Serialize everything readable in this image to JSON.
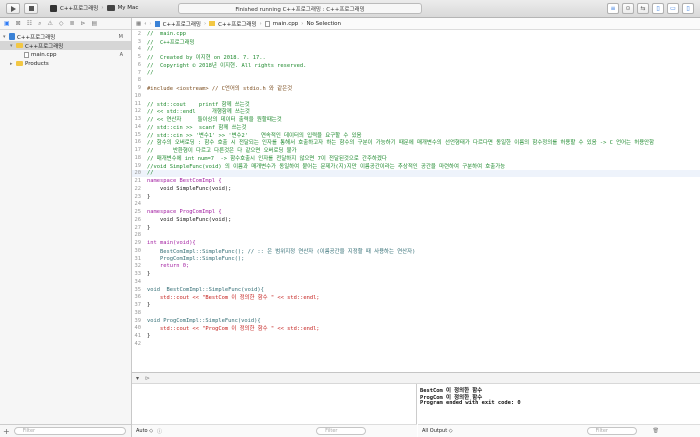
{
  "toolbar": {
    "scheme_target": "C++프로그래밍",
    "scheme_device": "My Mac",
    "status_text": "Finished running C++프로그래밍 : C++프로그래밍"
  },
  "navigator": {
    "project": {
      "name": "C++프로그래밍",
      "badge": "M"
    },
    "group": {
      "name": "C++프로그래밍"
    },
    "file": {
      "name": "main.cpp",
      "badge": "A"
    },
    "products": {
      "name": "Products"
    },
    "filter_placeholder": "Filter"
  },
  "jumpbar": {
    "crumbs": [
      "C++프로그래밍",
      "C++프로그래밍",
      "main.cpp",
      "No Selection"
    ]
  },
  "editor": {
    "lines": [
      {
        "n": "2",
        "t": "//  main.cpp",
        "c": "c-comment"
      },
      {
        "n": "3",
        "t": "//  C++프로그래밍",
        "c": "c-comment"
      },
      {
        "n": "4",
        "t": "//",
        "c": "c-comment"
      },
      {
        "n": "5",
        "t": "//  Created by 이지현 on 2018. 7. 17..",
        "c": "c-comment"
      },
      {
        "n": "6",
        "t": "//  Copyright © 2018년 이지현. All rights reserved.",
        "c": "c-comment"
      },
      {
        "n": "7",
        "t": "//",
        "c": "c-comment"
      },
      {
        "n": "8",
        "t": "",
        "c": "c-plain"
      },
      {
        "n": "9",
        "t": "#include <iostream> // C언어의 stdio.h 와 같은것",
        "c": "c-pp"
      },
      {
        "n": "10",
        "t": "",
        "c": "c-plain"
      },
      {
        "n": "11",
        "t": "// std::cout    printf 함께 쓰는것",
        "c": "c-comment"
      },
      {
        "n": "12",
        "t": "// << std::endl     개행함께 쓰는것",
        "c": "c-comment"
      },
      {
        "n": "13",
        "t": "// << 연산자     둘이상의 데이터 출력을 원할때는것",
        "c": "c-comment"
      },
      {
        "n": "14",
        "t": "// std::cin >>  scanf 함께 쓰는것",
        "c": "c-comment"
      },
      {
        "n": "15",
        "t": "// std::cin >> '변수1' >> '변수2'    연속적인 데이터의 입력을 요구할 수 있음",
        "c": "c-comment"
      },
      {
        "n": "16",
        "t": "// 함수의 오버로딩 : 함수 호출 시 전달되는 인자를 통해서 호출하고자 하는 함수의 구분이 가능하기 때문에 매개변수의 선언형태가 다르다면 동일한 이름의 함수정의를 허용할 수 있음 -> C 언어는 허용안함",
        "c": "c-comment"
      },
      {
        "n": "17",
        "t": "//      반환형이 다르고 다른것은 다 같으면 오버로딩 불가",
        "c": "c-comment"
      },
      {
        "n": "18",
        "t": "// 매개변수에 int num=7  -> 함수호출시 인자를 전달하지 않으면 7이 전달된것으로 간주하겠다",
        "c": "c-comment"
      },
      {
        "n": "19",
        "t": "//void SimpleFunc(void) 의 이름과 매개변수가 동일하여 붙어는 문제가(지)지만 이름공간이라는 추상적인 공간을 마련하여 구분하여 호출가능",
        "c": "c-comment"
      },
      {
        "n": "20",
        "t": "//",
        "c": "c-comment",
        "cur": true
      },
      {
        "n": "21",
        "t": "namespace BestComImpl {",
        "c": "c-kw"
      },
      {
        "n": "22",
        "t": "    void SimpleFunc(void);",
        "c": "c-plain"
      },
      {
        "n": "23",
        "t": "}",
        "c": "c-plain"
      },
      {
        "n": "24",
        "t": "",
        "c": "c-plain"
      },
      {
        "n": "25",
        "t": "namespace ProgComImpl {",
        "c": "c-kw"
      },
      {
        "n": "26",
        "t": "    void SimpleFunc(void);",
        "c": "c-plain"
      },
      {
        "n": "27",
        "t": "}",
        "c": "c-plain"
      },
      {
        "n": "28",
        "t": "",
        "c": "c-plain"
      },
      {
        "n": "29",
        "t": "int main(void){",
        "c": "c-kw"
      },
      {
        "n": "30",
        "t": "    BestComImpl::SimpleFunc(); // :: 은 범위지정 연산자 (이름공간을 지정할 때 사용하는 연산자)",
        "c": "c-id"
      },
      {
        "n": "31",
        "t": "    ProgComImpl::SimpleFunc();",
        "c": "c-id"
      },
      {
        "n": "32",
        "t": "    return 0;",
        "c": "c-kw"
      },
      {
        "n": "33",
        "t": "}",
        "c": "c-plain"
      },
      {
        "n": "34",
        "t": "",
        "c": "c-plain"
      },
      {
        "n": "35",
        "t": "void  BestComImpl::SimpleFunc(void){",
        "c": "c-id"
      },
      {
        "n": "36",
        "t": "    std::cout << \"BestCom 이 정의한 함수 \" << std::endl;",
        "c": "c-str"
      },
      {
        "n": "37",
        "t": "}",
        "c": "c-plain"
      },
      {
        "n": "38",
        "t": "",
        "c": "c-plain"
      },
      {
        "n": "39",
        "t": "void ProgComImpl::SimpleFunc(void){",
        "c": "c-id"
      },
      {
        "n": "40",
        "t": "    std::cout << \"ProgCom 이 정의한 함수 \" << std::endl;",
        "c": "c-str"
      },
      {
        "n": "41",
        "t": "}",
        "c": "c-plain"
      },
      {
        "n": "42",
        "t": "",
        "c": "c-plain"
      }
    ]
  },
  "console": {
    "lines": [
      "BestCom 이 정의한 함수",
      "ProgCom 이 정의한 함수",
      "Program ended with exit code: 0"
    ]
  },
  "debug": {
    "auto_label": "Auto ◇",
    "output_label": "All Output ◇",
    "filter_placeholder": "Filter"
  }
}
